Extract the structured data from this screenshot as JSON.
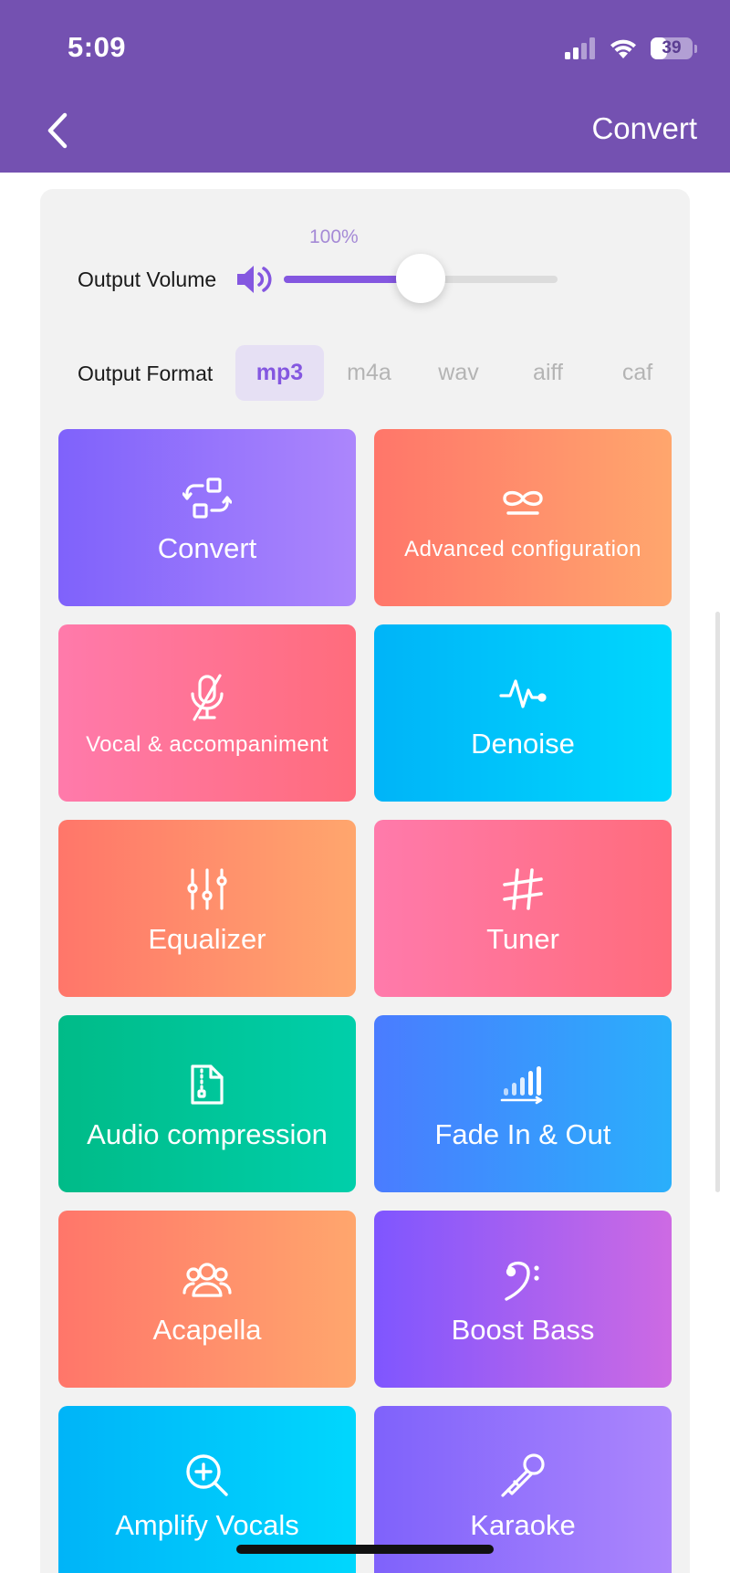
{
  "status_bar": {
    "time": "5:09",
    "battery": "39",
    "battery_level": 0.39
  },
  "header": {
    "action_label": "Convert",
    "color": "#7451b1"
  },
  "volume": {
    "label": "Output Volume",
    "value_text": "100%",
    "level": 0.5
  },
  "format": {
    "label": "Output Format",
    "options": [
      "mp3",
      "m4a",
      "wav",
      "aiff",
      "caf"
    ],
    "selected": "mp3"
  },
  "accent": "#8457e0",
  "tools": [
    {
      "title": "Convert",
      "icon": "convert-icon",
      "gradient": "purple"
    },
    {
      "title": "Advanced configuration",
      "icon": "infinity-icon",
      "gradient": "orange"
    },
    {
      "title": "Vocal & accompaniment",
      "icon": "mic-off-icon",
      "gradient": "pink"
    },
    {
      "title": "Denoise",
      "icon": "pulse-icon",
      "gradient": "cyan"
    },
    {
      "title": "Equalizer",
      "icon": "sliders-icon",
      "gradient": "orange"
    },
    {
      "title": "Tuner",
      "icon": "sharp-icon",
      "gradient": "pink"
    },
    {
      "title": "Audio compression",
      "icon": "zip-file-icon",
      "gradient": "green"
    },
    {
      "title": "Fade In & Out",
      "icon": "bars-icon",
      "gradient": "blue"
    },
    {
      "title": "Acapella",
      "icon": "group-icon",
      "gradient": "orange"
    },
    {
      "title": "Boost Bass",
      "icon": "bass-clef-icon",
      "gradient": "violet"
    },
    {
      "title": "Amplify Vocals",
      "icon": "zoom-in-icon",
      "gradient": "cyan"
    },
    {
      "title": "Karaoke",
      "icon": "karaoke-mic-icon",
      "gradient": "purple"
    }
  ]
}
